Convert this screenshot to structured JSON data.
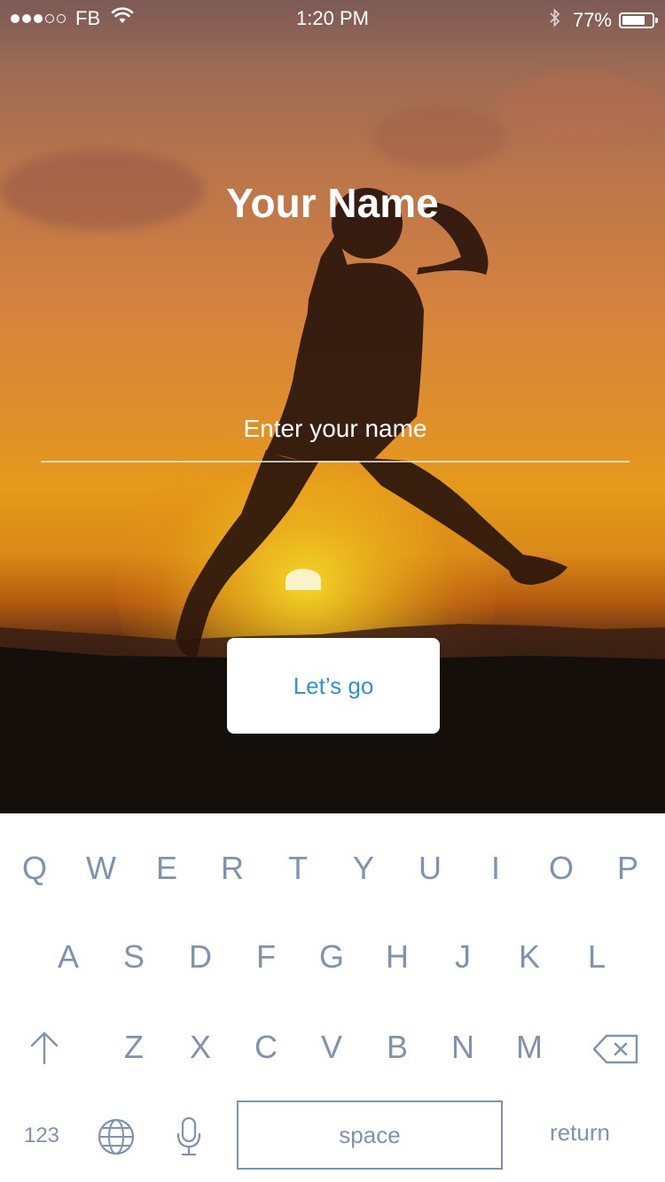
{
  "status_bar": {
    "signal_dots_filled": 3,
    "signal_dots_total": 5,
    "carrier": "FB",
    "time": "1:20 PM",
    "battery_percent": "77%",
    "battery_level": 0.77,
    "icons": [
      "wifi-icon",
      "bluetooth-icon",
      "battery-icon"
    ]
  },
  "screen": {
    "title": "Your Name",
    "name_input": {
      "placeholder": "Enter your name",
      "value": ""
    },
    "submit_label": "Let’s go"
  },
  "keyboard": {
    "rows": [
      [
        "Q",
        "W",
        "E",
        "R",
        "T",
        "Y",
        "U",
        "I",
        "O",
        "P"
      ],
      [
        "A",
        "S",
        "D",
        "F",
        "G",
        "H",
        "J",
        "K",
        "L"
      ],
      [
        "Z",
        "X",
        "C",
        "V",
        "B",
        "N",
        "M"
      ]
    ],
    "numbers_label": "123",
    "space_label": "space",
    "return_label": "return",
    "icons": [
      "shift-icon",
      "backspace-icon",
      "globe-icon",
      "microphone-icon"
    ]
  },
  "colors": {
    "accent": "#2a94d6",
    "key_text": "#7d93b0"
  }
}
